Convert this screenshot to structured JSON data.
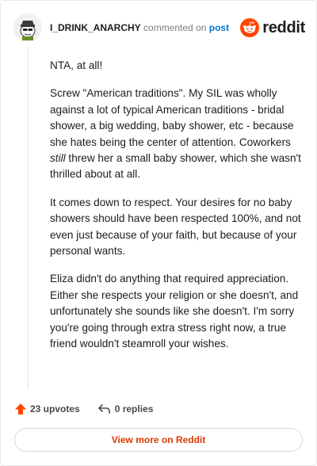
{
  "header": {
    "username": "I_DRINK_ANARCHY",
    "commented_text": "commented on",
    "post_link": "post",
    "logo_text": "reddit"
  },
  "comment": {
    "p1": "NTA, at all!",
    "p2_before": "Screw \"American traditions\". My SIL was wholly against a lot of typical American traditions - bridal shower, a big wedding, baby shower, etc - because she hates being the center of attention. Coworkers ",
    "p2_em": "still",
    "p2_after": " threw her a small baby shower, which she wasn't thrilled about at all.",
    "p3": "It comes down to respect. Your desires for no baby showers should have been respected 100%, and not even just because of your faith, but because of your personal wants.",
    "p4": "Eliza didn't do anything that required appreciation. Either she respects your religion or she doesn't, and unfortunately she sounds like she doesn't. I'm sorry you're going through extra stress right now, a true friend wouldn't steamroll your wishes."
  },
  "footer": {
    "upvotes": "23 upvotes",
    "replies": "0 replies",
    "view_more": "View more on Reddit"
  },
  "colors": {
    "accent": "#d93a00",
    "link": "#0079d3",
    "reddit_orange": "#ff4500"
  },
  "icons": {
    "upvote": "upvote-arrow-icon",
    "reply": "reply-arrow-icon",
    "logo": "reddit-snoo-icon"
  }
}
